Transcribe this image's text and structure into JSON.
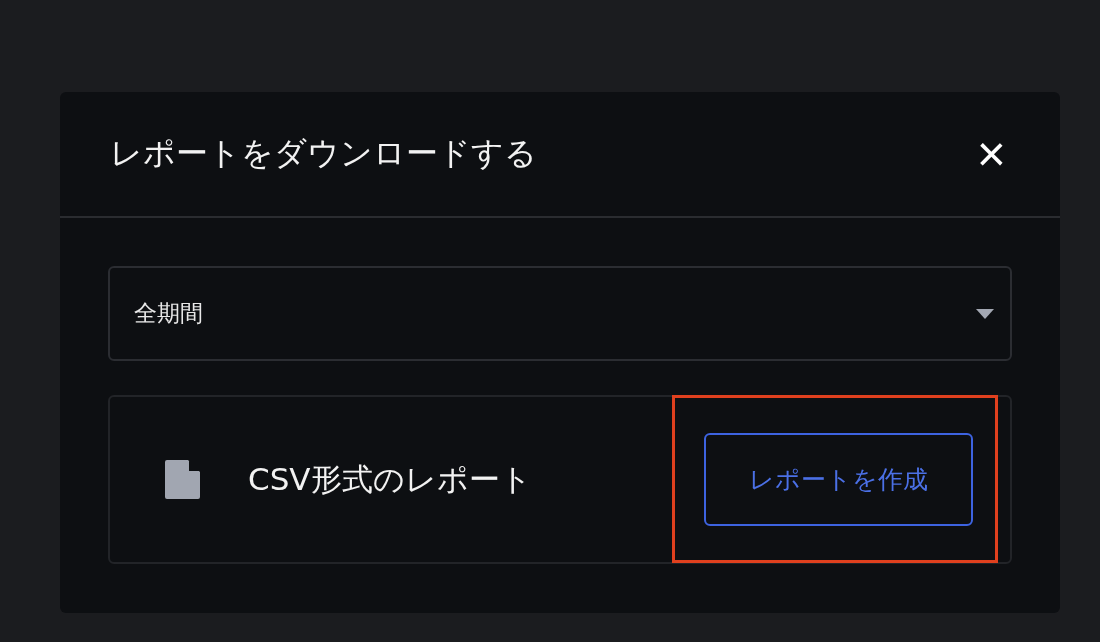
{
  "dialog": {
    "title": "レポートをダウンロードする",
    "close": "×"
  },
  "period_select": {
    "value": "全期間"
  },
  "report": {
    "label": "CSV形式のレポート",
    "button": "レポートを作成",
    "highlighted": true
  }
}
